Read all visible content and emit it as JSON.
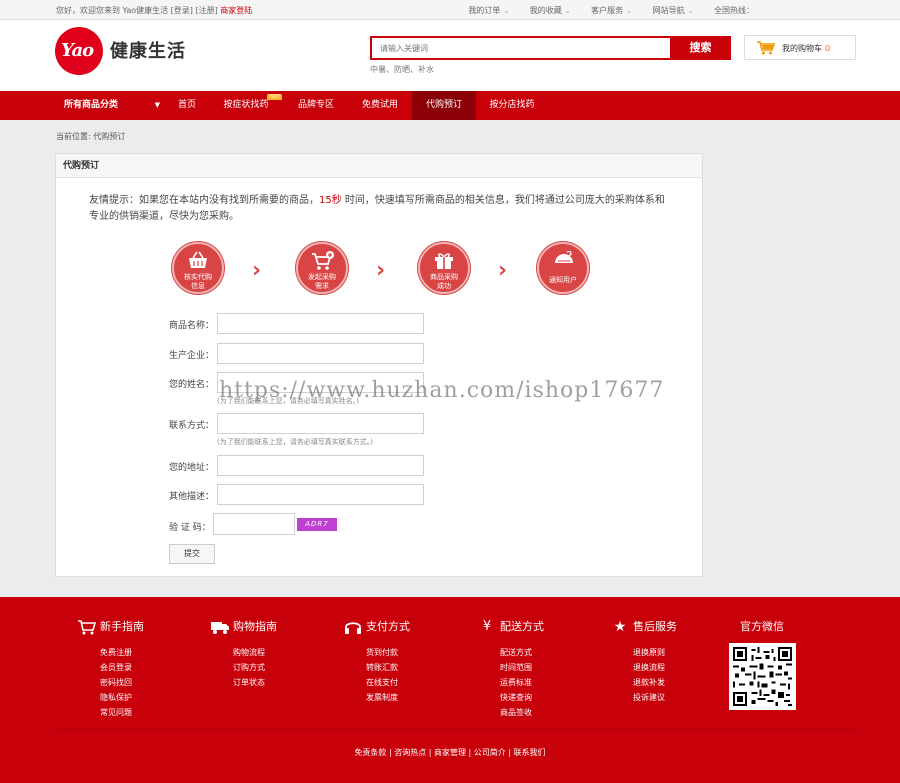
{
  "topbar": {
    "welcome_prefix": "您好，欢迎您来到 Yao健康生活 [",
    "login": "登录",
    "sep": "] [",
    "register": "注册",
    "suffix": "]",
    "merchant": "商家登陆",
    "links": [
      "我的订单",
      "我的收藏",
      "客户服务",
      "网站导航"
    ],
    "hotline": "全国热线："
  },
  "logo": {
    "mark": "Yao",
    "text": "健康生活"
  },
  "search": {
    "placeholder": "请输入关键词",
    "button": "搜索",
    "hotwords": "中暑、防晒、补水"
  },
  "cart": {
    "label": "我的购物车",
    "count": "0"
  },
  "nav": {
    "category": "所有商品分类",
    "items": [
      "首页",
      "按症状找药",
      "品牌专区",
      "免费试用",
      "代购预订",
      "按分店找药"
    ],
    "hot_badge": "HOT",
    "active_index": 4
  },
  "breadcrumb": "当前位置: 代购预订",
  "panel": {
    "title": "代购预订",
    "tip_before": "友情提示：如果您在本站内没有找到所需要的商品，",
    "tip_highlight": "15秒",
    "tip_after": " 时间，快速填写所需商品的相关信息，我们将通过公司庞大的采购体系和专业的供销渠道，尽快为您采购。",
    "steps": [
      {
        "line1": "核实代购",
        "line2": "信息",
        "icon": "basket-icon"
      },
      {
        "line1": "发起采购",
        "line2": "需求",
        "icon": "cart-plus-icon"
      },
      {
        "line1": "商品采购",
        "line2": "成功",
        "icon": "gift-icon"
      },
      {
        "line1": "通知用户",
        "line2": "",
        "icon": "phone-icon"
      }
    ],
    "form": {
      "product_name": "商品名称：",
      "manufacturer": "生产企业：",
      "your_name": "您的姓名：",
      "name_note": "(为了我们能联系上您，请务必填写真实姓名。)",
      "contact": "联系方式：",
      "contact_note": "(为了我们能联系上您，请务必填写真实联系方式。)",
      "address": "您的地址：",
      "other": "其他描述：",
      "captcha_label": "验 证 码：",
      "captcha_text": "ADR7",
      "submit": "提交"
    }
  },
  "watermark": "https://www.huzhan.com/ishop17677",
  "footer": {
    "columns": [
      {
        "title": "新手指南",
        "icon": "cart-icon",
        "items": [
          "免费注册",
          "会员登录",
          "密码找回",
          "隐私保护",
          "常见问题"
        ]
      },
      {
        "title": "购物指南",
        "icon": "truck-icon",
        "items": [
          "购物流程",
          "订购方式",
          "订单状态"
        ]
      },
      {
        "title": "支付方式",
        "icon": "headset-icon",
        "items": [
          "货到付款",
          "转账汇款",
          "在线支付",
          "发票制度"
        ]
      },
      {
        "title": "配送方式",
        "icon": "yen-icon",
        "items": [
          "配送方式",
          "时间范围",
          "运费标准",
          "快递查询",
          "商品签收"
        ]
      },
      {
        "title": "售后服务",
        "icon": "star-icon",
        "items": [
          "退换原则",
          "退换流程",
          "退款补发",
          "投诉建议"
        ]
      },
      {
        "title": "官方微信",
        "icon": "",
        "items": []
      }
    ],
    "links": "免责条款 | 咨询热点 | 商家管理 | 公司简介 | 联系我们"
  }
}
